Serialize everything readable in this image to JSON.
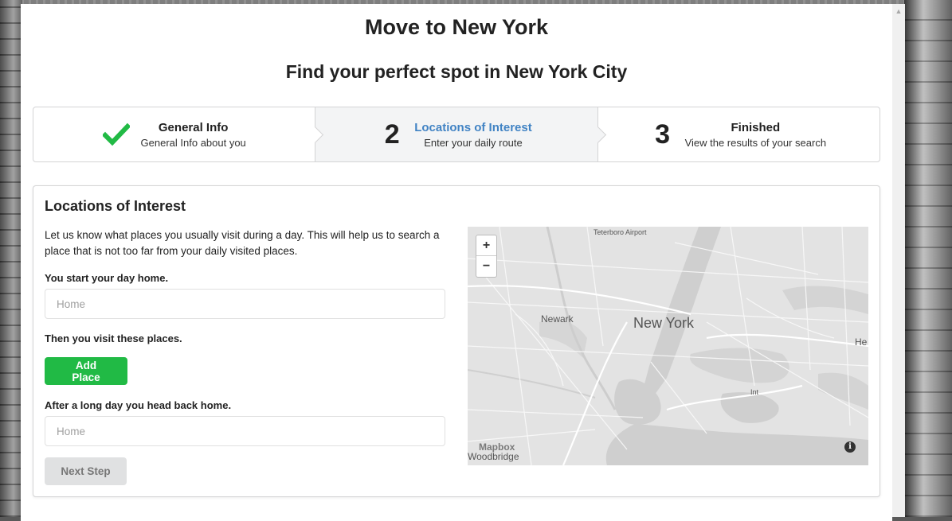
{
  "header": {
    "title": "Move to New York",
    "subtitle": "Find your perfect spot in New York City"
  },
  "steps": [
    {
      "number": "",
      "title": "General Info",
      "description": "General Info about you",
      "state": "completed",
      "icon": "checkmark-icon"
    },
    {
      "number": "2",
      "title": "Locations of Interest",
      "description": "Enter your daily route",
      "state": "active"
    },
    {
      "number": "3",
      "title": "Finished",
      "description": "View the results of your search",
      "state": "pending"
    }
  ],
  "form": {
    "title": "Locations of Interest",
    "intro": "Let us know what places you usually visit during a day. This will help us to search a place that is not too far from your daily visited places.",
    "start_label": "You start your day home.",
    "start_placeholder": "Home",
    "visit_label": "Then you visit these places.",
    "add_place_label": "Add Place",
    "end_label": "After a long day you head back home.",
    "end_placeholder": "Home",
    "next_label": "Next Step"
  },
  "map": {
    "zoom_in": "+",
    "zoom_out": "−",
    "labels": {
      "teterboro": "Teterboro Airport",
      "newark": "Newark",
      "new_york": "New York",
      "he": "He",
      "int": "Int",
      "woodbridge": "Woodbridge",
      "mapbox": "Mapbox"
    },
    "info": "i"
  },
  "colors": {
    "accent_blue": "#4183c4",
    "success_green": "#21ba45",
    "check_green": "#21ba45",
    "step_active_bg": "#f3f4f5"
  }
}
